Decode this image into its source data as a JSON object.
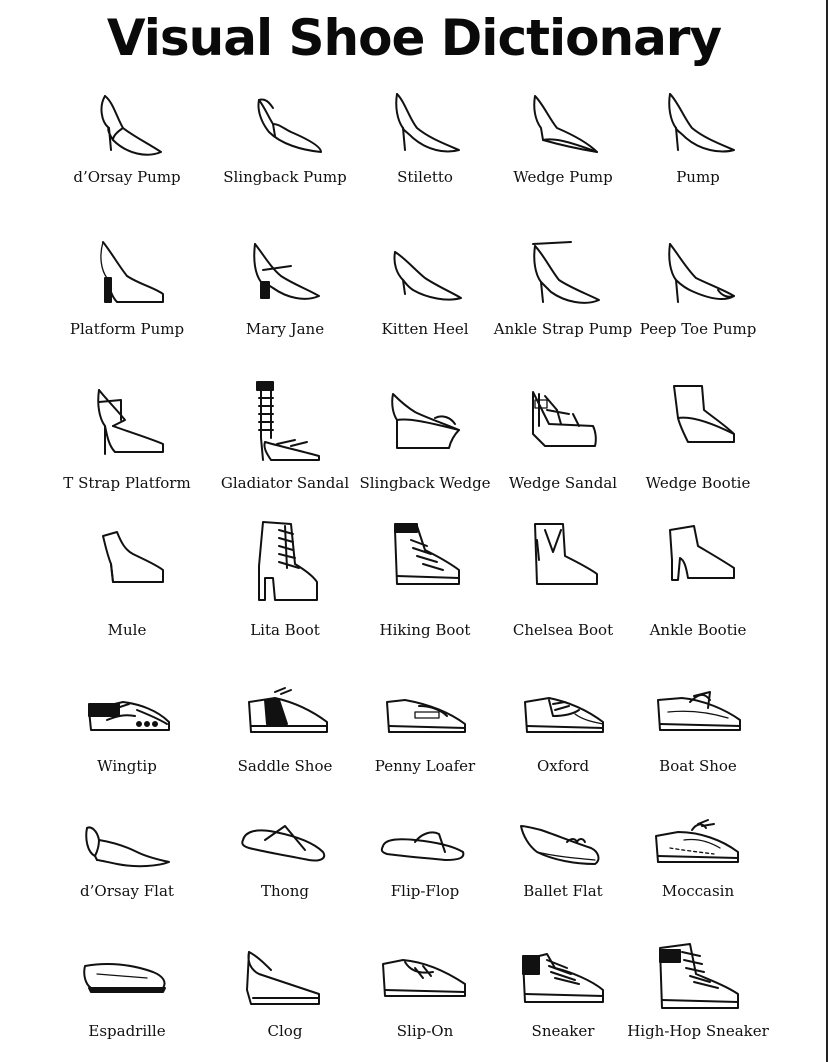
{
  "title": "Visual Shoe Dictionary",
  "rows": [
    [
      {
        "label": "d’Orsay Pump",
        "icon": "dorsay-pump-icon"
      },
      {
        "label": "Slingback Pump",
        "icon": "slingback-pump-icon"
      },
      {
        "label": "Stiletto",
        "icon": "stiletto-icon"
      },
      {
        "label": "Wedge Pump",
        "icon": "wedge-pump-icon"
      },
      {
        "label": "Pump",
        "icon": "pump-icon"
      }
    ],
    [
      {
        "label": "Platform Pump",
        "icon": "platform-pump-icon"
      },
      {
        "label": "Mary Jane",
        "icon": "mary-jane-icon"
      },
      {
        "label": "Kitten Heel",
        "icon": "kitten-heel-icon"
      },
      {
        "label": "Ankle Strap Pump",
        "icon": "ankle-strap-pump-icon"
      },
      {
        "label": "Peep Toe Pump",
        "icon": "peep-toe-pump-icon"
      }
    ],
    [
      {
        "label": "T Strap Platform",
        "icon": "t-strap-platform-icon"
      },
      {
        "label": "Gladiator Sandal",
        "icon": "gladiator-sandal-icon"
      },
      {
        "label": "Slingback Wedge",
        "icon": "slingback-wedge-icon"
      },
      {
        "label": "Wedge Sandal",
        "icon": "wedge-sandal-icon"
      },
      {
        "label": "Wedge Bootie",
        "icon": "wedge-bootie-icon"
      }
    ],
    [
      {
        "label": "Mule",
        "icon": "mule-icon"
      },
      {
        "label": "Lita Boot",
        "icon": "lita-boot-icon"
      },
      {
        "label": "Hiking Boot",
        "icon": "hiking-boot-icon"
      },
      {
        "label": "Chelsea Boot",
        "icon": "chelsea-boot-icon"
      },
      {
        "label": "Ankle Bootie",
        "icon": "ankle-bootie-icon"
      }
    ],
    [
      {
        "label": "Wingtip",
        "icon": "wingtip-icon"
      },
      {
        "label": "Saddle Shoe",
        "icon": "saddle-shoe-icon"
      },
      {
        "label": "Penny Loafer",
        "icon": "penny-loafer-icon"
      },
      {
        "label": "Oxford",
        "icon": "oxford-icon"
      },
      {
        "label": "Boat Shoe",
        "icon": "boat-shoe-icon"
      }
    ],
    [
      {
        "label": "d’Orsay Flat",
        "icon": "dorsay-flat-icon"
      },
      {
        "label": "Thong",
        "icon": "thong-icon"
      },
      {
        "label": "Flip-Flop",
        "icon": "flip-flop-icon"
      },
      {
        "label": "Ballet Flat",
        "icon": "ballet-flat-icon"
      },
      {
        "label": "Moccasin",
        "icon": "moccasin-icon"
      }
    ],
    [
      {
        "label": "Espadrille",
        "icon": "espadrille-icon"
      },
      {
        "label": "Clog",
        "icon": "clog-icon"
      },
      {
        "label": "Slip-On",
        "icon": "slip-on-icon"
      },
      {
        "label": "Sneaker",
        "icon": "sneaker-icon"
      },
      {
        "label": "High-Hop Sneaker",
        "icon": "high-top-sneaker-icon"
      }
    ]
  ]
}
